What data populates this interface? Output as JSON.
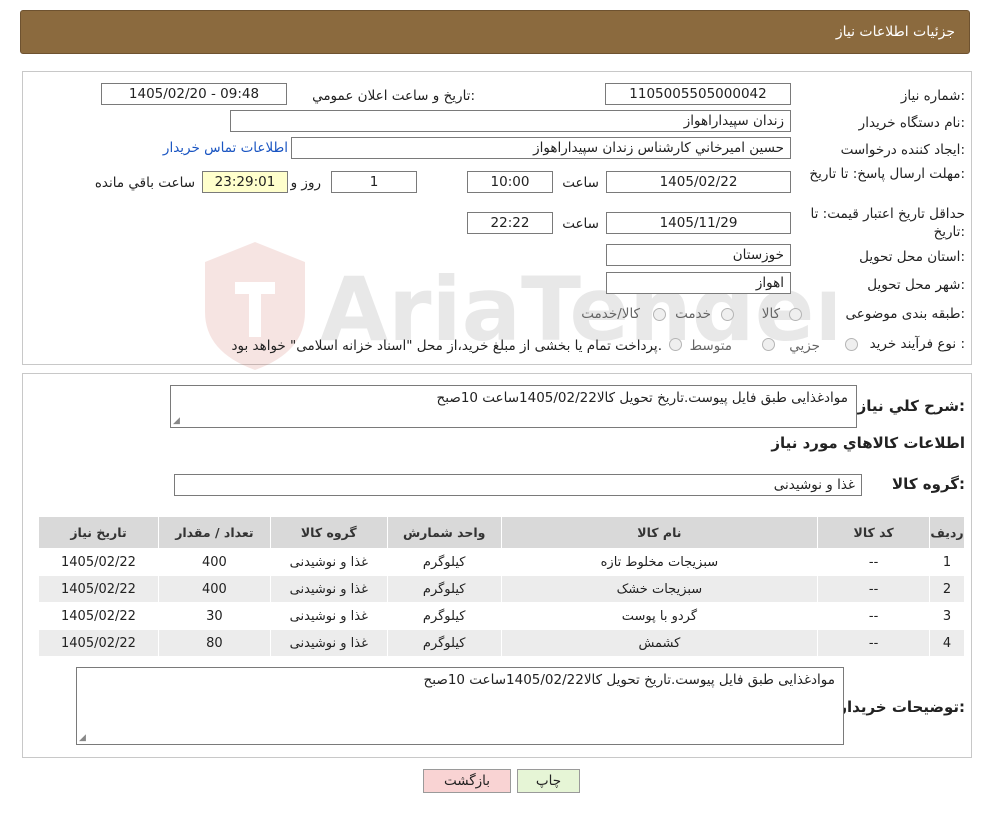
{
  "header": {
    "title": "جزئیات اطلاعات نیاز"
  },
  "form": {
    "need_number_label": "شماره نیاز:",
    "need_number": "1105005505000042",
    "announce_label": "تاریخ و ساعت اعلان عمومي:",
    "announce_value": "1405/02/20 - 09:48",
    "buyer_org_label": "نام دستگاه خريدار:",
    "buyer_org": "زندان سپيداراهواز",
    "creator_label": "ايجاد كننده درخواست:",
    "creator": "حسين اميرخاني كارشناس زندان سپيداراهواز",
    "contact_link": "اطلاعات تماس خريدار",
    "send_deadline_label": "مهلت ارسال پاسخ: تا تاريخ:",
    "send_date": "1405/02/22",
    "time_label": "ساعت",
    "send_time": "10:00",
    "days_value": "1",
    "days_label": "روز و",
    "remaining_value": "23:29:01",
    "remaining_label": "ساعت باقي مانده",
    "validity_label": "حداقل تاريخ اعتبار قيمت: تا تاريخ:",
    "validity_date": "1405/11/29",
    "validity_time": "22:22",
    "province_label": "استان محل تحويل:",
    "province": "خوزستان",
    "city_label": "شهر محل تحويل:",
    "city": "اهواز",
    "category_label": "طبقه بندی موضوعی:",
    "category_options": [
      "كالا",
      "خدمت",
      "كالا/خدمت"
    ],
    "process_label": "نوع فرآيند خريد :",
    "process_options": [
      "جزيي",
      "متوسط"
    ],
    "process_note": "پرداخت تمام يا بخشی از مبلغ خريد،از محل \"اسناد خزانه اسلامی\" خواهد بود."
  },
  "details": {
    "summary_label": "شرح كلي نياز:",
    "summary_text": "موادغذایی طبق فایل پیوست.تاریخ تحویل کالا1405/02/22ساعت 10صبح",
    "goods_heading": "اطلاعات كالاهاي مورد نياز",
    "goods_group_label": "گروه كالا:",
    "goods_group": "غذا و نوشيدنی"
  },
  "table": {
    "headers": [
      "رديف",
      "كد كالا",
      "نام كالا",
      "واحد شمارش",
      "گروه كالا",
      "تعداد / مقدار",
      "تاريخ نياز"
    ],
    "rows": [
      [
        "1",
        "--",
        "سبزيجات مخلوط تازه",
        "كيلوگرم",
        "غذا و نوشيدنی",
        "400",
        "1405/02/22"
      ],
      [
        "2",
        "--",
        "سبزيجات خشک",
        "كيلوگرم",
        "غذا و نوشيدنی",
        "400",
        "1405/02/22"
      ],
      [
        "3",
        "--",
        "گردو با پوست",
        "كيلوگرم",
        "غذا و نوشيدنی",
        "30",
        "1405/02/22"
      ],
      [
        "4",
        "--",
        "كشمش",
        "كيلوگرم",
        "غذا و نوشيدنی",
        "80",
        "1405/02/22"
      ]
    ]
  },
  "buyer_notes": {
    "label": "توضيحات خريدار:",
    "text": "موادغذایی طبق فایل پیوست.تاریخ تحویل کالا1405/02/22ساعت 10صبح"
  },
  "buttons": {
    "back": "بازگشت",
    "print": "چاپ"
  },
  "watermark": {
    "text": "AriaTender.neT"
  },
  "colors": {
    "header_bg": "#8b6a3e",
    "link": "#1a55c2",
    "remaining_bg": "#ffffcc",
    "back_btn": "#f9d3d3",
    "print_btn": "#e6f5d6"
  }
}
